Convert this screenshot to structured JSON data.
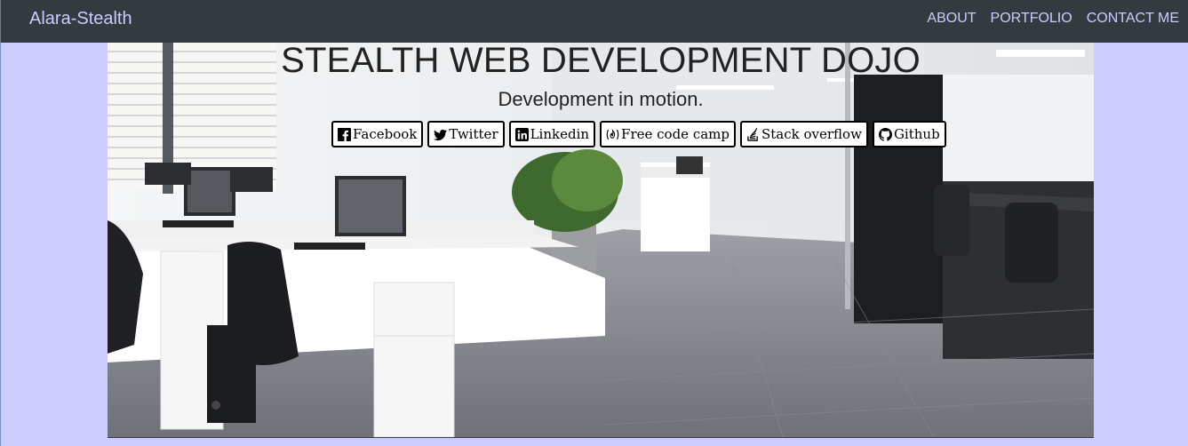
{
  "navbar": {
    "brand": "Alara-Stealth",
    "links": [
      {
        "label": "ABOUT"
      },
      {
        "label": "PORTFOLIO"
      },
      {
        "label": "CONTACT ME"
      }
    ]
  },
  "hero": {
    "title": "STEALTH WEB DEVELOPMENT DOJO",
    "subtitle": "Development in motion.",
    "social": [
      {
        "label": "Facebook",
        "icon": "facebook-icon"
      },
      {
        "label": "Twitter",
        "icon": "twitter-icon"
      },
      {
        "label": "Linkedin",
        "icon": "linkedin-icon"
      },
      {
        "label": "Free code camp",
        "icon": "freecodecamp-icon"
      },
      {
        "label": "Stack overflow",
        "icon": "stackoverflow-icon"
      },
      {
        "label": "Github",
        "icon": "github-icon"
      }
    ]
  },
  "colors": {
    "navbar_bg": "#343a40",
    "nav_text": "#ccccff",
    "page_bg": "#ccccff"
  }
}
